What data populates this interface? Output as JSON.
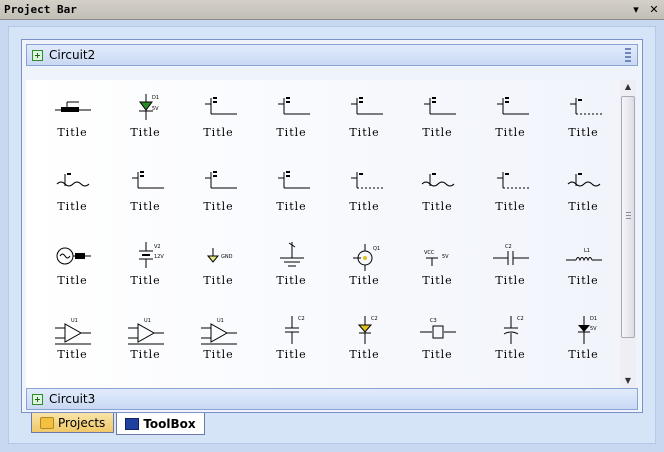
{
  "window": {
    "title": "Project Bar",
    "pin_icon": "▾",
    "close_icon": "✕"
  },
  "groups": [
    {
      "name": "Circuit2"
    },
    {
      "name": "Circuit3"
    }
  ],
  "components": [
    {
      "label": "Title",
      "symbol": "switch-bar"
    },
    {
      "label": "Title",
      "symbol": "zener-diode"
    },
    {
      "label": "Title",
      "symbol": "probe"
    },
    {
      "label": "Title",
      "symbol": "probe"
    },
    {
      "label": "Title",
      "symbol": "probe"
    },
    {
      "label": "Title",
      "symbol": "probe"
    },
    {
      "label": "Title",
      "symbol": "probe"
    },
    {
      "label": "Title",
      "symbol": "probe-dashed"
    },
    {
      "label": "Title",
      "symbol": "probe-wave"
    },
    {
      "label": "Title",
      "symbol": "probe"
    },
    {
      "label": "Title",
      "symbol": "probe"
    },
    {
      "label": "Title",
      "symbol": "probe"
    },
    {
      "label": "Title",
      "symbol": "probe-dashed"
    },
    {
      "label": "Title",
      "symbol": "probe-wave"
    },
    {
      "label": "Title",
      "symbol": "probe-dashed"
    },
    {
      "label": "Title",
      "symbol": "probe-wave"
    },
    {
      "label": "Title",
      "symbol": "ac-source"
    },
    {
      "label": "Title",
      "symbol": "battery"
    },
    {
      "label": "Title",
      "symbol": "ground-gnd"
    },
    {
      "label": "Title",
      "symbol": "earth"
    },
    {
      "label": "Title",
      "symbol": "transistor"
    },
    {
      "label": "Title",
      "symbol": "vcc"
    },
    {
      "label": "Title",
      "symbol": "capacitor-h"
    },
    {
      "label": "Title",
      "symbol": "inductor"
    },
    {
      "label": "Title",
      "symbol": "opamp"
    },
    {
      "label": "Title",
      "symbol": "opamp"
    },
    {
      "label": "Title",
      "symbol": "opamp"
    },
    {
      "label": "Title",
      "symbol": "capacitor-v"
    },
    {
      "label": "Title",
      "symbol": "varactor"
    },
    {
      "label": "Title",
      "symbol": "crystal"
    },
    {
      "label": "Title",
      "symbol": "electrolytic"
    },
    {
      "label": "Title",
      "symbol": "zener-v"
    },
    {
      "label": "",
      "symbol": "partial-d"
    },
    {
      "label": "",
      "symbol": "partial-led"
    },
    {
      "label": "",
      "symbol": "partial-switch"
    }
  ],
  "tabs": [
    {
      "label": "Projects",
      "icon": "folder-icon"
    },
    {
      "label": "ToolBox",
      "icon": "toolbox-icon"
    }
  ]
}
